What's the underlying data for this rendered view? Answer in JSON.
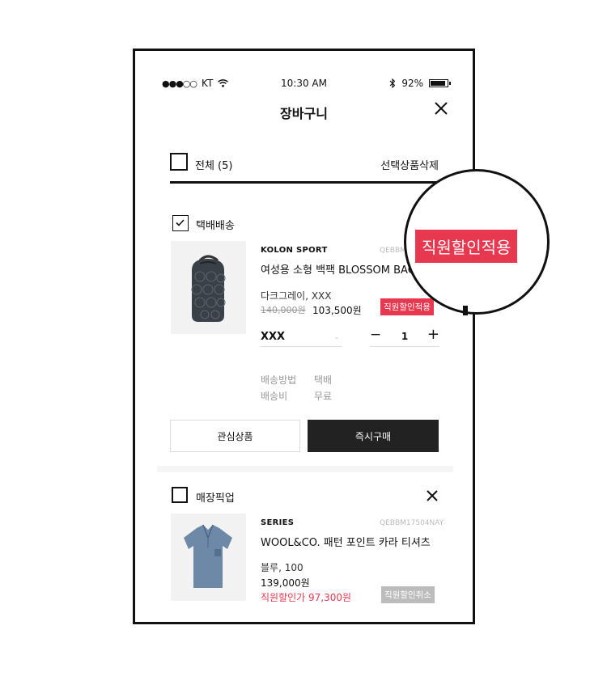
{
  "status_bar": {
    "carrier": "KT",
    "signal": "●●●○○",
    "time": "10:30 AM",
    "battery": "92%"
  },
  "header": {
    "title": "장바구니"
  },
  "select_all": {
    "label": "전체 (5)",
    "delete_label": "선택상품삭제",
    "checked": false
  },
  "sections": [
    {
      "label": "택배배송",
      "checked": true,
      "item": {
        "brand": "KOLON SPORT",
        "code": "QEBBM",
        "name": "여성용 소형 백팩 BLOSSOM BAG",
        "option": "다크그레이, XXX",
        "original_price": "140,000원",
        "price": "103,500원",
        "badge": "직원할인적용",
        "select_value": "XXX",
        "quantity": "1",
        "shipping": [
          {
            "key": "배송방법",
            "value": "택배"
          },
          {
            "key": "배송비",
            "value": "무료"
          }
        ]
      },
      "buttons": {
        "wish": "관심상품",
        "buy": "즉시구매"
      }
    },
    {
      "label": "매장픽업",
      "checked": false,
      "item": {
        "brand": "SERIES",
        "code": "QEBBM17504NAY",
        "name": "WOOL&CO. 패턴 포인트 카라 티셔츠",
        "option": "블루, 100",
        "price": "139,000원",
        "discount_price": "직원할인가 97,300원",
        "badge": "직원할인취소"
      }
    }
  ],
  "zoom": {
    "badge": "직원할인적용"
  },
  "colors": {
    "accent": "#e83850",
    "dark": "#222222",
    "muted": "#bcbcbc"
  }
}
